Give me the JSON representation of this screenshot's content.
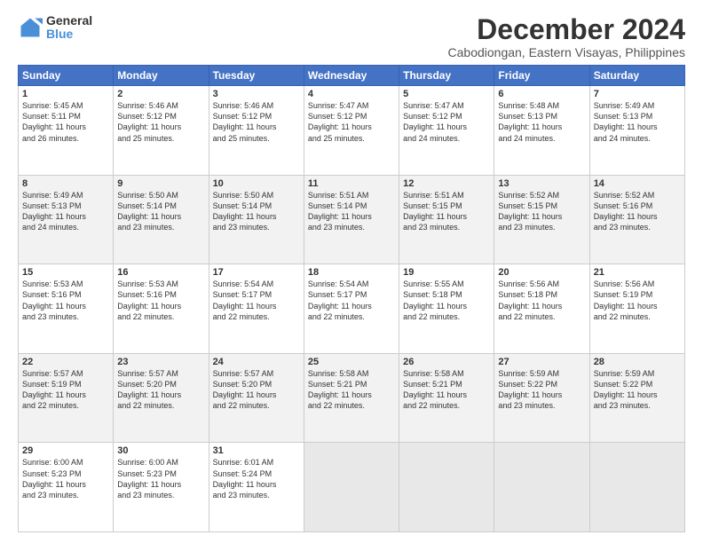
{
  "logo": {
    "line1": "General",
    "line2": "Blue"
  },
  "title": "December 2024",
  "subtitle": "Cabodiongan, Eastern Visayas, Philippines",
  "headers": [
    "Sunday",
    "Monday",
    "Tuesday",
    "Wednesday",
    "Thursday",
    "Friday",
    "Saturday"
  ],
  "weeks": [
    [
      {
        "day": "1",
        "info": "Sunrise: 5:45 AM\nSunset: 5:11 PM\nDaylight: 11 hours\nand 26 minutes."
      },
      {
        "day": "2",
        "info": "Sunrise: 5:46 AM\nSunset: 5:12 PM\nDaylight: 11 hours\nand 25 minutes."
      },
      {
        "day": "3",
        "info": "Sunrise: 5:46 AM\nSunset: 5:12 PM\nDaylight: 11 hours\nand 25 minutes."
      },
      {
        "day": "4",
        "info": "Sunrise: 5:47 AM\nSunset: 5:12 PM\nDaylight: 11 hours\nand 25 minutes."
      },
      {
        "day": "5",
        "info": "Sunrise: 5:47 AM\nSunset: 5:12 PM\nDaylight: 11 hours\nand 24 minutes."
      },
      {
        "day": "6",
        "info": "Sunrise: 5:48 AM\nSunset: 5:13 PM\nDaylight: 11 hours\nand 24 minutes."
      },
      {
        "day": "7",
        "info": "Sunrise: 5:49 AM\nSunset: 5:13 PM\nDaylight: 11 hours\nand 24 minutes."
      }
    ],
    [
      {
        "day": "8",
        "info": "Sunrise: 5:49 AM\nSunset: 5:13 PM\nDaylight: 11 hours\nand 24 minutes."
      },
      {
        "day": "9",
        "info": "Sunrise: 5:50 AM\nSunset: 5:14 PM\nDaylight: 11 hours\nand 23 minutes."
      },
      {
        "day": "10",
        "info": "Sunrise: 5:50 AM\nSunset: 5:14 PM\nDaylight: 11 hours\nand 23 minutes."
      },
      {
        "day": "11",
        "info": "Sunrise: 5:51 AM\nSunset: 5:14 PM\nDaylight: 11 hours\nand 23 minutes."
      },
      {
        "day": "12",
        "info": "Sunrise: 5:51 AM\nSunset: 5:15 PM\nDaylight: 11 hours\nand 23 minutes."
      },
      {
        "day": "13",
        "info": "Sunrise: 5:52 AM\nSunset: 5:15 PM\nDaylight: 11 hours\nand 23 minutes."
      },
      {
        "day": "14",
        "info": "Sunrise: 5:52 AM\nSunset: 5:16 PM\nDaylight: 11 hours\nand 23 minutes."
      }
    ],
    [
      {
        "day": "15",
        "info": "Sunrise: 5:53 AM\nSunset: 5:16 PM\nDaylight: 11 hours\nand 23 minutes."
      },
      {
        "day": "16",
        "info": "Sunrise: 5:53 AM\nSunset: 5:16 PM\nDaylight: 11 hours\nand 22 minutes."
      },
      {
        "day": "17",
        "info": "Sunrise: 5:54 AM\nSunset: 5:17 PM\nDaylight: 11 hours\nand 22 minutes."
      },
      {
        "day": "18",
        "info": "Sunrise: 5:54 AM\nSunset: 5:17 PM\nDaylight: 11 hours\nand 22 minutes."
      },
      {
        "day": "19",
        "info": "Sunrise: 5:55 AM\nSunset: 5:18 PM\nDaylight: 11 hours\nand 22 minutes."
      },
      {
        "day": "20",
        "info": "Sunrise: 5:56 AM\nSunset: 5:18 PM\nDaylight: 11 hours\nand 22 minutes."
      },
      {
        "day": "21",
        "info": "Sunrise: 5:56 AM\nSunset: 5:19 PM\nDaylight: 11 hours\nand 22 minutes."
      }
    ],
    [
      {
        "day": "22",
        "info": "Sunrise: 5:57 AM\nSunset: 5:19 PM\nDaylight: 11 hours\nand 22 minutes."
      },
      {
        "day": "23",
        "info": "Sunrise: 5:57 AM\nSunset: 5:20 PM\nDaylight: 11 hours\nand 22 minutes."
      },
      {
        "day": "24",
        "info": "Sunrise: 5:57 AM\nSunset: 5:20 PM\nDaylight: 11 hours\nand 22 minutes."
      },
      {
        "day": "25",
        "info": "Sunrise: 5:58 AM\nSunset: 5:21 PM\nDaylight: 11 hours\nand 22 minutes."
      },
      {
        "day": "26",
        "info": "Sunrise: 5:58 AM\nSunset: 5:21 PM\nDaylight: 11 hours\nand 22 minutes."
      },
      {
        "day": "27",
        "info": "Sunrise: 5:59 AM\nSunset: 5:22 PM\nDaylight: 11 hours\nand 23 minutes."
      },
      {
        "day": "28",
        "info": "Sunrise: 5:59 AM\nSunset: 5:22 PM\nDaylight: 11 hours\nand 23 minutes."
      }
    ],
    [
      {
        "day": "29",
        "info": "Sunrise: 6:00 AM\nSunset: 5:23 PM\nDaylight: 11 hours\nand 23 minutes."
      },
      {
        "day": "30",
        "info": "Sunrise: 6:00 AM\nSunset: 5:23 PM\nDaylight: 11 hours\nand 23 minutes."
      },
      {
        "day": "31",
        "info": "Sunrise: 6:01 AM\nSunset: 5:24 PM\nDaylight: 11 hours\nand 23 minutes."
      },
      {
        "day": "",
        "info": ""
      },
      {
        "day": "",
        "info": ""
      },
      {
        "day": "",
        "info": ""
      },
      {
        "day": "",
        "info": ""
      }
    ]
  ]
}
